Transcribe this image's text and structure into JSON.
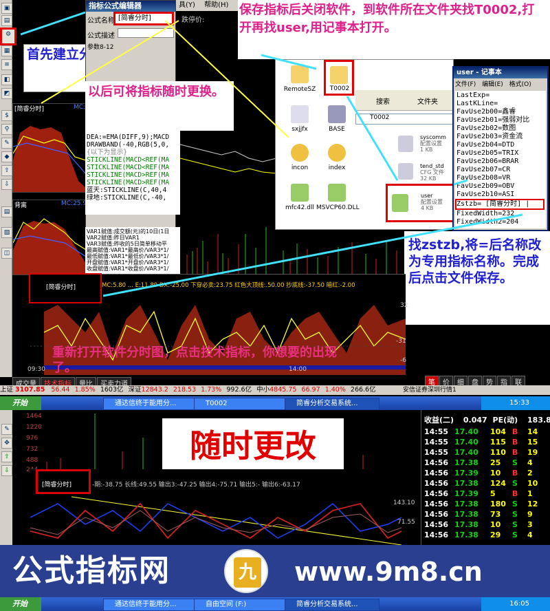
{
  "editor": {
    "title": "指标公式编辑器",
    "menu_fragments": [
      "具(Y)",
      "帮助(H)"
    ],
    "formula_name_label": "公式名称",
    "formula_name_value": "[简睿分时]",
    "formula_desc_label": "公式描述",
    "fall_price_label": "跌停价:",
    "param_fragment": "参数8-12",
    "code_lines": [
      "DEA:=EMA(DIFF,9);MACD",
      "DRAWBAND(-40,RGB(5,0,",
      "{以下为显示}",
      "STICKLINE(MACD<REF(MA",
      "STICKLINE(MACD<REF(MA",
      "STICKLINE(MACD>REF(MA",
      "STICKLINE(MACD>REF(MA",
      "蓝天:STICKLINE(C,40,4",
      "绿地:STICKLINE(C,-40,"
    ],
    "var_lines": [
      "VAR1赋值:成交额(元)的10日(1日",
      "VAR2赋值:昨日VAR1",
      "VAR3赋值:昨收的5日简单移动平",
      "最高赋值:VAR1*最高价/VAR3*1/",
      "最低赋值:VAR1*最低价/VAR3*1/",
      "开盘赋值:VAR1*开盘价/VAR3*1/",
      "收盘赋值:VAR1*收盘价/VAR3*1/"
    ]
  },
  "annotations": {
    "step1": "首先建立分时专用指标",
    "step1_sub": "以后可将指标随时更换。",
    "step2": "保存指标后关闭软件，到软件所在文件夹找T0002,打开再找user,用记事本打开。",
    "step3": "找zstzb,将=后名称改为专用指标名称。完成后点击文件保存。",
    "step4": "重新打开软件分时图，点击技术指标，你想要的出现了。",
    "big_banner": "随时更改"
  },
  "explorer": {
    "folders": [
      "RemoteSZ",
      "T0002"
    ],
    "files": [
      "sxjjfx",
      "BASE",
      "incon",
      "index",
      "mfc42.dll",
      "MSVCP60.DLL"
    ],
    "toolbar_search": "搜索",
    "toolbar_folders": "文件夹",
    "address_fragment": "T0002",
    "right_files": [
      {
        "name": "syscomm",
        "type": "配置设置",
        "size": "1 KB"
      },
      {
        "name": "tend_std",
        "type": "CFG 文件",
        "size": "32 KB"
      },
      {
        "name": "user",
        "type": "配置设置",
        "size": "4 KB"
      }
    ]
  },
  "notepad": {
    "title": "user - 记事本",
    "menu": [
      "文件(F)",
      "编辑(E)",
      "格式(O)"
    ],
    "lines": [
      "LastExp=",
      "LastKLine=",
      "FavUse2b00=鑫睿",
      "FavUse2b01=强弱对比",
      "FavUse2b02=数图",
      "FavUse2b03=资金流",
      "FavUse2b04=DTD",
      "FavUse2b05=TRIX",
      "FavUse2b06=BRAR",
      "FavUse2b07=CR",
      "FavUse2b08=VR",
      "FavUse2b09=OBV",
      "FavUse2b10=ASI",
      "Zstzb= [简睿分时] |",
      "FixedWidth=232",
      "FixedWidth2=204"
    ]
  },
  "chart_top": {
    "panel_label_1": "[简睿分时]",
    "panel_mc_1": "MC:",
    "panel_label_2": "背离",
    "panel_mc_2": "MC:25.98",
    "indicator_label": "[简睿分时]",
    "indicator_readout": "MC:5.80 ... E:11.89  DX:-25.00  下穿必卖:23.75  红色大顶线:.50.00  抄底线:-37.50  暗红:-2.00",
    "y_ticks": [
      "32",
      "-31",
      "-6"
    ],
    "x_ticks": [
      "09:30",
      "14:00"
    ],
    "bottom_tabs": [
      "成交量",
      "技术指标",
      "量比",
      "买卖力道"
    ],
    "right_tabs": [
      "笔",
      "价",
      "细",
      "盘",
      "势",
      "指",
      "联"
    ],
    "trade_small": "安信证券深圳行情1"
  },
  "index_bar": {
    "label": "上证",
    "sh_value": "3107.85",
    "sh_change": "56.44",
    "sh_pct": "1.85%",
    "sh_amount": "1603亿",
    "sz_label": "深证",
    "sz_value": "12843.2",
    "sz_change": "218.53",
    "sz_pct": "1.73%",
    "sz_amount": "992.6亿",
    "zx_label": "中小",
    "zx_value": "4845.75",
    "zx_change": "66.97",
    "zx_pct": "1.40%",
    "zx_amount": "266.6亿"
  },
  "taskbar_1": {
    "start": "开始",
    "tasks": [
      "通达信终于能用分...",
      "T0002",
      "简睿分析交易系统..."
    ],
    "clock": "15:33"
  },
  "chart_bottom": {
    "y_ticks_vol": [
      "1464",
      "1220",
      "976",
      "732",
      "488",
      "244"
    ],
    "indicator_label": "[简睿分时]",
    "indicator_readout": "-期:-38.75  长线:49.55  输出3:-47.25  输出4:-75.71  输出5:-  输出6:-63.17",
    "y_ticks_ind": [
      "143.10",
      "71.55"
    ],
    "quote_header_label": "收益(二)",
    "quote_header_value": "0.047",
    "pe_label": "PE(动)",
    "pe_value": "183.8",
    "trades": [
      {
        "time": "14:55",
        "price": "17.40",
        "vol": "104",
        "bs": "B",
        "n": "14"
      },
      {
        "time": "14:55",
        "price": "17.40",
        "vol": "115",
        "bs": "B",
        "n": "15"
      },
      {
        "time": "14:55",
        "price": "17.40",
        "vol": "110",
        "bs": "B",
        "n": "19"
      },
      {
        "time": "14:56",
        "price": "17.38",
        "vol": "25",
        "bs": "S",
        "n": "4"
      },
      {
        "time": "14:56",
        "price": "17.39",
        "vol": "10",
        "bs": "B",
        "n": "2"
      },
      {
        "time": "14:56",
        "price": "17.38",
        "vol": "124",
        "bs": "S",
        "n": "10"
      },
      {
        "time": "14:56",
        "price": "17.39",
        "vol": "5",
        "bs": "B",
        "n": "1"
      },
      {
        "time": "14:56",
        "price": "17.38",
        "vol": "180",
        "bs": "S",
        "n": "12"
      },
      {
        "time": "14:56",
        "price": "17.38",
        "vol": "73",
        "bs": "S",
        "n": "9"
      },
      {
        "time": "14:56",
        "price": "17.38",
        "vol": "10",
        "bs": "S",
        "n": "3"
      },
      {
        "time": "14:56",
        "price": "17.38",
        "vol": "29",
        "bs": "S",
        "n": "4"
      }
    ]
  },
  "footer": {
    "brand_cn": "公式指标网",
    "brand_url": "www.9m8.cn",
    "seal": "九",
    "taskbar_start": "开始",
    "tasks": [
      "通达信终于能用分...",
      "自由空间 (F:)",
      "简睿分析交易系统..."
    ],
    "clock": "16:05"
  },
  "colors": {
    "accent_red": "#e00000",
    "note_pink": "#e0208a",
    "note_blue": "#2020d0",
    "footer_blue": "#2a3f8f",
    "chart_bg": "#000000",
    "area_red": "#a02010"
  }
}
